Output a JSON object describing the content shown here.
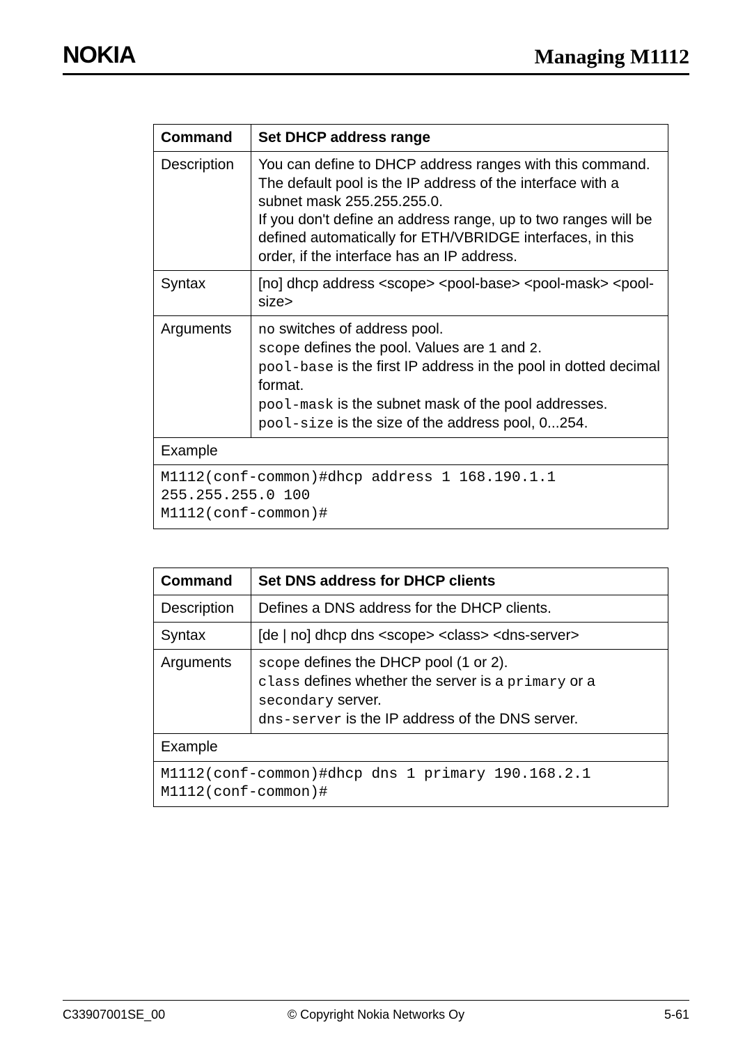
{
  "header": {
    "logo": "NOKIA",
    "title": "Managing M1112"
  },
  "table1": {
    "hdr_label": "Command",
    "hdr_value": "Set DHCP address range",
    "desc_label": "Description",
    "desc_value": "You can define to DHCP address ranges with this command. The default pool is the IP address of the interface with a subnet mask 255.255.255.0.\nIf you don't define an address range, up to two ranges will be defined automatically for ETH/VBRIDGE interfaces, in this order, if the interface has an IP address.",
    "syntax_label": "Syntax",
    "syntax_value": "[no] dhcp address <scope> <pool-base> <pool-mask> <pool-size>",
    "args_label": "Arguments",
    "args": {
      "no_code": "no",
      "no_after": " switches of address pool.",
      "scope_code": "scope",
      "scope_mid": " defines the pool. Values are ",
      "scope_v1": "1",
      "scope_and": " and ",
      "scope_v2": "2",
      "scope_end": ".",
      "poolbase_code": "pool-base",
      "poolbase_after": " is the first IP address in the pool in dotted decimal format.",
      "poolmask_code": "pool-mask",
      "poolmask_after": " is the subnet mask of the pool addresses.",
      "poolsize_code": "pool-size",
      "poolsize_after": " is the size of the address pool, 0...254."
    },
    "example_label": "Example",
    "example_code": "M1112(conf-common)#dhcp address 1 168.190.1.1\n255.255.255.0 100\nM1112(conf-common)#"
  },
  "table2": {
    "hdr_label": "Command",
    "hdr_value": "Set DNS address for DHCP clients",
    "desc_label": "Description",
    "desc_value": "Defines a DNS address for the DHCP clients.",
    "syntax_label": "Syntax",
    "syntax_value": "[de | no] dhcp dns <scope> <class> <dns-server>",
    "args_label": "Arguments",
    "args": {
      "scope_code": "scope",
      "scope_after": " defines the DHCP pool (1 or 2).",
      "class_code": "class",
      "class_mid": " defines whether the server is a ",
      "class_primary": "primary",
      "class_or": " or a ",
      "class_secondary": "secondary",
      "class_end": " server.",
      "dns_code": "dns-server",
      "dns_after": " is the IP address of the DNS server."
    },
    "example_label": "Example",
    "example_code": "M1112(conf-common)#dhcp dns 1 primary 190.168.2.1\nM1112(conf-common)#"
  },
  "footer": {
    "left": "C33907001SE_00",
    "center": "© Copyright Nokia Networks Oy",
    "right": "5-61"
  }
}
